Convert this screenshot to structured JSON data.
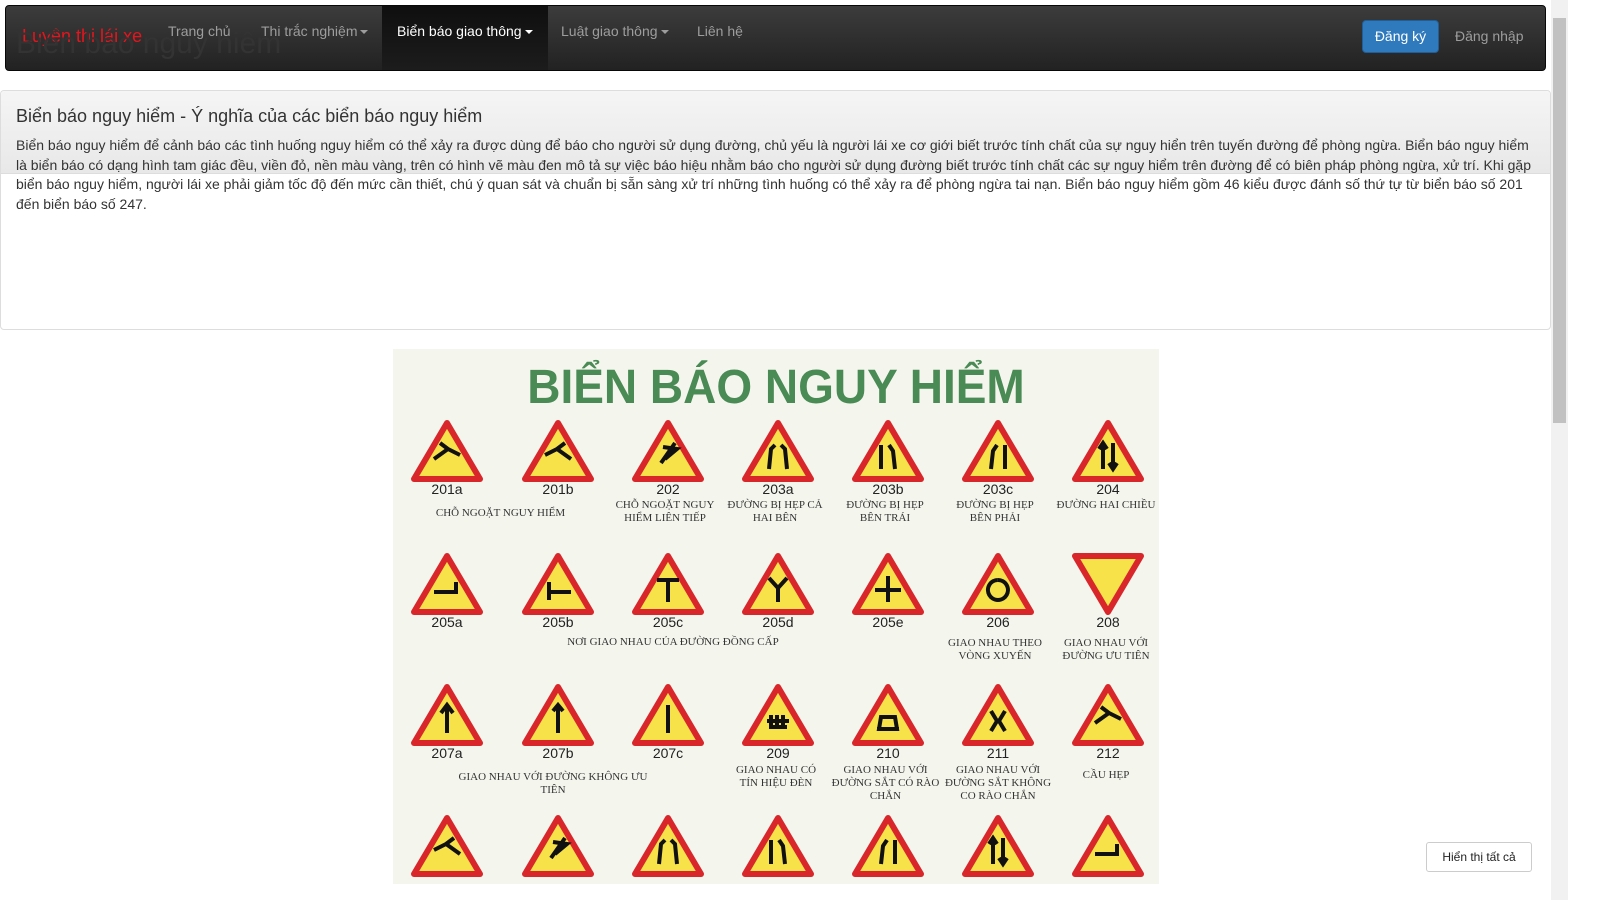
{
  "nav": {
    "brand": "Luyện thi lái xe",
    "items": [
      {
        "label": "Trang chủ",
        "dropdown": false,
        "active": false
      },
      {
        "label": "Thi trắc nghiệm",
        "dropdown": true,
        "active": false
      },
      {
        "label": "Biển báo giao thông",
        "dropdown": true,
        "active": true
      },
      {
        "label": "Luật giao thông",
        "dropdown": true,
        "active": false
      },
      {
        "label": "Liên hệ",
        "dropdown": false,
        "active": false
      }
    ],
    "register": "Đăng ký",
    "login": "Đăng nhập"
  },
  "panel": {
    "title": "Biển báo nguy hiểm",
    "subtitle": "Biển báo nguy hiểm - Ý nghĩa của các biển báo nguy hiểm",
    "description": "Biển báo nguy hiểm để cảnh báo các tình huống nguy hiểm có thể xảy ra được dùng để báo cho người sử dụng đường, chủ yếu là người lái xe cơ giới biết trước tính chất của sự nguy hiển trên tuyến đường để phòng ngừa. Biển báo nguy hiểm là biển báo có dạng hình tam giác đều, viền đỏ, nền màu vàng, trên có hình vẽ màu đen mô tả sự việc báo hiệu nhằm báo cho người sử dụng đường biết trước tính chất các sự nguy hiểm trên đường để có biên pháp phòng ngừa, xử trí. Khi gặp biển báo nguy hiểm, người lái xe phải giảm tốc độ đến mức cần thiết, chú ý quan sát và chuẩn bị sẵn sàng xử trí những tình huống có thể xảy ra để phòng ngừa tai nạn. Biển báo nguy hiểm gồm 46 kiểu được đánh số thứ tự từ biển báo số 201 đến biển báo số 247."
  },
  "poster": {
    "title": "BIỂN BÁO NGUY HIỂM",
    "codes": [
      "201a",
      "201b",
      "202",
      "203a",
      "203b",
      "203c",
      "204",
      "205a",
      "205b",
      "205c",
      "205d",
      "205e",
      "206",
      "208",
      "207a",
      "207b",
      "207c",
      "209",
      "210",
      "211",
      "212"
    ],
    "captions": [
      "CHỖ NGOẶT NGUY HIỂM",
      "CHỖ NGOẶT NGUY HIỂM LIÊN TIẾP",
      "ĐƯỜNG BỊ HẸP CẢ HAI BÊN",
      "ĐƯỜNG BỊ HẸP BÊN TRÁI",
      "ĐƯỜNG BỊ HẸP BÊN PHẢI",
      "ĐƯỜNG HAI CHIỀU",
      "NƠI GIAO NHAU CỦA ĐƯỜNG ĐỒNG CẤP",
      "GIAO NHAU THEO VÒNG XUYẾN",
      "GIAO NHAU VỚI ĐƯỜNG ƯU TIÊN",
      "GIAO NHAU VỚI ĐƯỜNG KHÔNG ƯU TIÊN",
      "GIAO NHAU CÓ TÍN HIỆU ĐÈN",
      "GIAO NHAU VỚI ĐƯỜNG SẮT CÓ RÀO CHẮN",
      "GIAO NHAU VỚI ĐƯỜNG SẮT KHÔNG Co RÀO CHẮN",
      "CẦU HẸP"
    ],
    "sign_colors": {
      "border": "#d9262b",
      "fill": "#f7e24a",
      "symbol": "#111111"
    }
  },
  "show_all": "Hiển thị tất cả"
}
